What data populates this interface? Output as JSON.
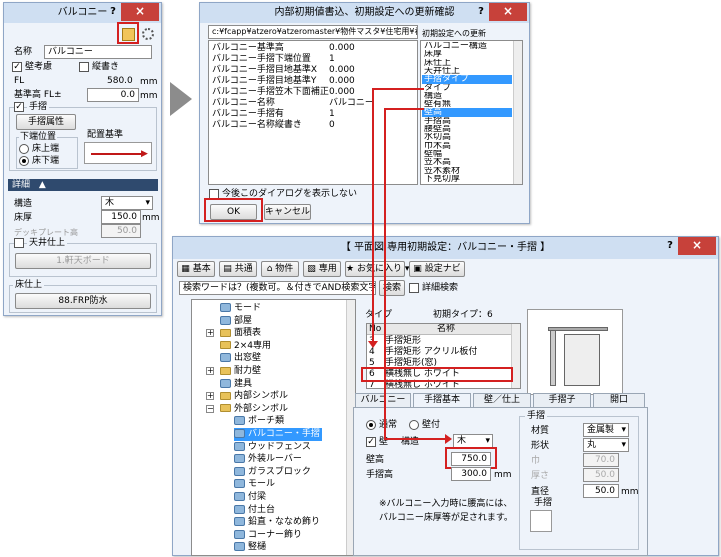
{
  "balcony": {
    "title": "バルコニー",
    "name_label": "名称",
    "name_value": "バルコニー",
    "wall_consider": "壁考慮",
    "vertical": "縦書き",
    "fl_label": "FL",
    "fl_value": "580.0",
    "unit": "mm",
    "base_label": "基準高 FL±",
    "base_value": "0.0",
    "handrail": "手摺",
    "handrail_attr": "手摺属性",
    "lower_pos": "下端位置",
    "layout_base": "配置基準",
    "floor_top": "床上端",
    "floor_bottom": "床下端",
    "detail": "詳細",
    "structure_label": "構造",
    "structure_value": "木",
    "floor_thick_label": "床厚",
    "floor_thick_value": "150.0",
    "deck_label": "デッキプレート高",
    "deck_value": "50.0",
    "ceiling_finish": "天井仕上",
    "ceiling_value": "1.軒天ボード",
    "floor_finish": "床仕上",
    "floor_finish_value": "88.FRP防水"
  },
  "confirm": {
    "title": "内部初期値書込、初期設定への更新確認",
    "path": "c:¥fcapp¥atzero¥atzeromaster¥物件マスタ¥住宅用¥初期値",
    "update_label": "初期設定への更新",
    "params": [
      {
        "k": "バルコニー基準高",
        "v": "0.000"
      },
      {
        "k": "バルコニー手摺下端位置",
        "v": "1"
      },
      {
        "k": "バルコニー手摺目地基準X",
        "v": "0.000"
      },
      {
        "k": "バルコニー手摺目地基準Y",
        "v": "0.000"
      },
      {
        "k": "バルコニー手摺笠木下面補正",
        "v": "0.000"
      },
      {
        "k": "バルコニー名称",
        "v": "バルコニー"
      },
      {
        "k": "バルコニー手摺有",
        "v": "1"
      },
      {
        "k": "バルコニー名称縦書き",
        "v": "0"
      }
    ],
    "items": [
      "バルコニー構造",
      "床厚",
      "床仕上",
      "天井仕上",
      "手摺タイプ",
      "タイプ",
      "構造",
      "壁有無",
      "壁高",
      "手摺高",
      "腰壁高",
      "水切高",
      "巾木高",
      "壁幅",
      "笠木高",
      "笠木素材",
      "下見切厚"
    ],
    "dont_show": "今後このダイアログを表示しない",
    "ok": "OK",
    "cancel": "キャンセル"
  },
  "settings": {
    "title": "【 平面図 専用初期設定：バルコニー・手摺 】",
    "tb_basic": "基本",
    "tb_common": "共通",
    "tb_property": "物件",
    "tb_dedicated": "専用",
    "tb_favorite": "お気に入り",
    "tb_navi": "設定ナビ",
    "search_placeholder": "検索ワードは？(複数可。＆付きでAND検索文字)",
    "search_btn": "検索",
    "detail_search": "詳細検索",
    "tree": [
      "モード",
      "部屋",
      "面積表",
      "2×4専用",
      "出窓壁",
      "耐力壁",
      "建具",
      "内部シンボル",
      "外部シンボル",
      "ポーチ類",
      "バルコニー・手摺",
      "ウッドフェンス",
      "外装ルーバー",
      "ガラスブロック",
      "モール",
      "付梁",
      "付土台",
      "鉛直・ななめ飾り",
      "コーナー飾り",
      "竪樋"
    ],
    "type_label": "タイプ",
    "initial_type": "初期タイプ：6",
    "col_no": "No",
    "col_name": "名称",
    "types": [
      {
        "no": "3",
        "name": "手摺矩形"
      },
      {
        "no": "4",
        "name": "手摺矩形 アクリル板付"
      },
      {
        "no": "5",
        "name": "手摺矩形(窓)"
      },
      {
        "no": "6",
        "name": "横桟無し ホワイト"
      },
      {
        "no": "7",
        "name": "横桟無し ホワイト"
      }
    ],
    "tabs": [
      "バルコニー",
      "手摺基本",
      "壁／仕上",
      "手摺子",
      "開口"
    ],
    "normal": "通常",
    "wall_attach": "壁付",
    "wall": "壁",
    "structure": "構造",
    "structure_value": "木",
    "wall_height": "壁高",
    "wall_height_value": "750.0",
    "rail_height": "手摺高",
    "rail_height_value": "300.0",
    "unit": "mm",
    "note1": "※バルコニー入力時に腰高には、",
    "note2": "バルコニー床厚等が足されます。",
    "rail_group": "手摺",
    "material": "材質",
    "material_value": "金属製",
    "shape": "形状",
    "shape_value": "丸",
    "width_label": "巾",
    "width_value": "70.0",
    "thick_label": "厚さ",
    "thick_value": "50.0",
    "diameter_label": "直径",
    "diameter_value": "50.0",
    "rail_preview": "手摺"
  },
  "colors": {
    "accent_red": "#d42020",
    "select_blue": "#3399ff",
    "title_bg": "#cfdff2",
    "close_red": "#c7413a"
  }
}
